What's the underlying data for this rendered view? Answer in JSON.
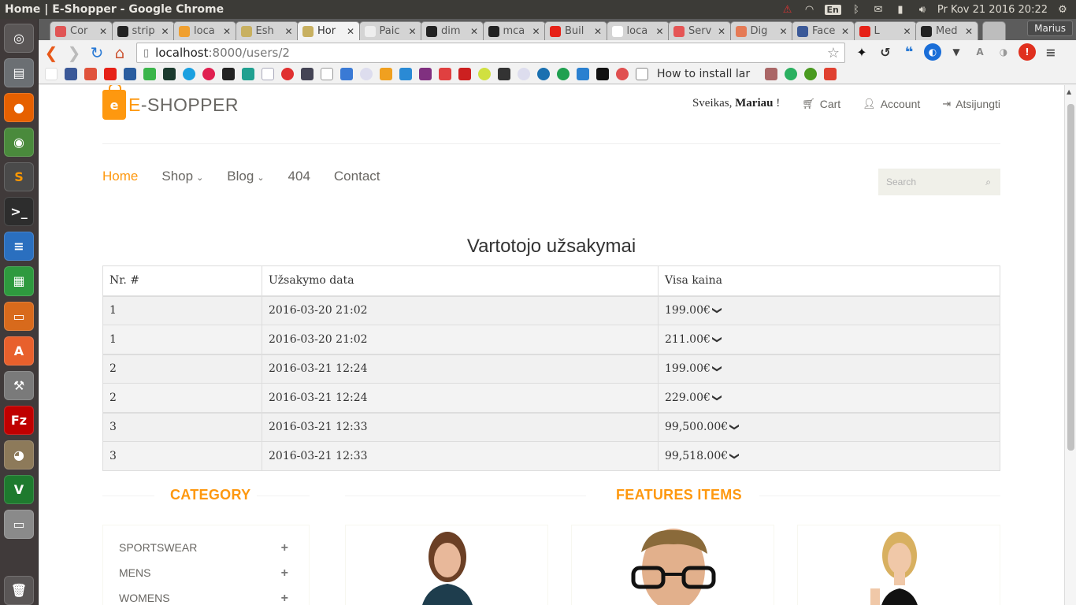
{
  "window": {
    "title": "Home | E-Shopper - Google Chrome"
  },
  "tray": {
    "lang": "En",
    "clock": "Pr Kov 21 2016 20:22"
  },
  "tabs": [
    {
      "label": "Cor",
      "color": "#e05555"
    },
    {
      "label": "strip",
      "color": "#222222"
    },
    {
      "label": "loca",
      "color": "#f0a030"
    },
    {
      "label": "Esh",
      "color": "#c8b060"
    },
    {
      "label": "Hor",
      "color": "#c8b060",
      "active": true
    },
    {
      "label": "Paic",
      "color": "#eeeeee"
    },
    {
      "label": "dim",
      "color": "#222222"
    },
    {
      "label": "mca",
      "color": "#222222"
    },
    {
      "label": "Buil",
      "color": "#e62117"
    },
    {
      "label": "loca",
      "color": "#ffffff"
    },
    {
      "label": "Serv",
      "color": "#e55555"
    },
    {
      "label": "Dig",
      "color": "#e57a55"
    },
    {
      "label": "Face",
      "color": "#3b5998"
    },
    {
      "label": "L",
      "color": "#e62117"
    },
    {
      "label": "Med",
      "color": "#222222"
    }
  ],
  "profile": {
    "name": "Marius"
  },
  "omnibox": {
    "host": "localhost",
    "path": ":8000/users/2"
  },
  "bookmarks": {
    "last_label": "How to install lar"
  },
  "site": {
    "logo_e": "E",
    "logo_rest": "-SHOPPER",
    "greeting_prefix": "Sveikas, ",
    "greeting_name": "Mariau",
    "greeting_suffix": " !",
    "top_menu": {
      "cart": "Cart",
      "account": "Account",
      "logout": "Atsijungti"
    },
    "main_menu": {
      "home": "Home",
      "shop": "Shop",
      "blog": "Blog",
      "notfound": "404",
      "contact": "Contact"
    },
    "search_placeholder": "Search"
  },
  "orders": {
    "title": "Vartotojo užsakymai",
    "columns": [
      "Nr. #",
      "Užsakymo data",
      "Visa kaina"
    ],
    "rows": [
      {
        "nr": "1",
        "date": "2016-03-20 21:02",
        "price": "199.00€"
      },
      {
        "nr": "1",
        "date": "2016-03-20 21:02",
        "price": "211.00€"
      },
      {
        "nr": "2",
        "date": "2016-03-21 12:24",
        "price": "199.00€"
      },
      {
        "nr": "2",
        "date": "2016-03-21 12:24",
        "price": "229.00€"
      },
      {
        "nr": "3",
        "date": "2016-03-21 12:33",
        "price": "99,500.00€"
      },
      {
        "nr": "3",
        "date": "2016-03-21 12:33",
        "price": "99,518.00€"
      }
    ]
  },
  "sections": {
    "category": "CATEGORY",
    "features": "FEATURES ITEMS",
    "categories": [
      "SPORTSWEAR",
      "MENS",
      "WOMENS"
    ]
  },
  "colors": {
    "brand": "#fe980f"
  }
}
